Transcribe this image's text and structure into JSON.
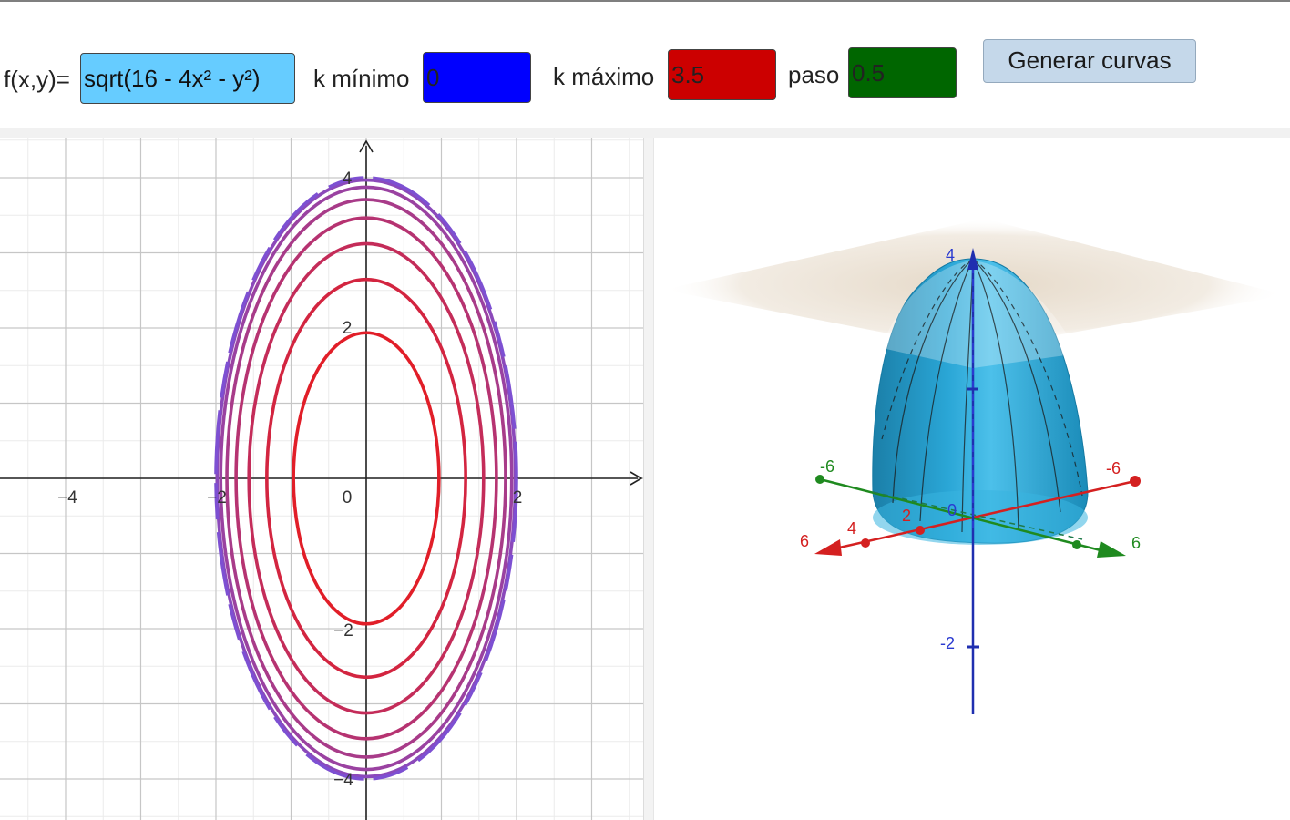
{
  "toolbar": {
    "function_label": "f(x,y)=",
    "function_value": "sqrt(16 - 4x² - y²)",
    "kmin_label": "k mínimo",
    "kmin_value": "0",
    "kmax_label": "k máximo",
    "kmax_value": "3.5",
    "step_label": "paso",
    "step_value": "0.5",
    "generate_label": "Generar curvas"
  },
  "colors": {
    "function_field": "#66ccff",
    "kmin_field": "#0000ff",
    "kmax_field": "#cc0000",
    "step_field": "#006600",
    "button": "#c5d8ea",
    "surface": "#1fa0d0",
    "plane": "#e8dccb"
  },
  "graph2d": {
    "x_ticks": [
      "−4",
      "−2",
      "0",
      "2"
    ],
    "y_ticks": [
      "4",
      "2",
      "−2",
      "−4"
    ],
    "level_values": [
      3.5,
      3.0,
      2.5,
      2.0,
      1.5,
      1.0,
      0.5,
      0
    ]
  },
  "graph3d": {
    "x_axis_labels": [
      "6",
      "4",
      "2",
      "-6"
    ],
    "y_axis_labels": [
      "-6",
      "2",
      "4",
      "6"
    ],
    "z_axis_labels": [
      "4",
      "2",
      "-2"
    ],
    "origin_label": "0"
  }
}
